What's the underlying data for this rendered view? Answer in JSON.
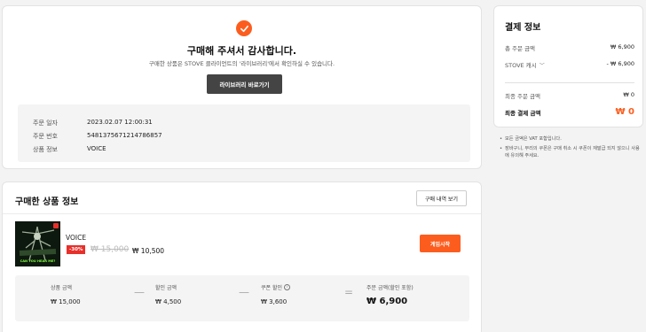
{
  "confirm": {
    "title": "구매해 주셔서 감사합니다.",
    "subtitle": "구매한 상품은 STOVE 클라이언트의 '라이브러리'에서 확인하실 수 있습니다.",
    "library_button": "라이브러리 바로가기",
    "order": [
      {
        "label": "주문 일자",
        "value": "2023.02.07 12:00:31"
      },
      {
        "label": "주문 번호",
        "value": "5481375671214786857"
      },
      {
        "label": "상품 정보",
        "value": "VOICE"
      }
    ]
  },
  "products": {
    "header": "구매한 상품 정보",
    "history_button": "구매 내역 보기",
    "item": {
      "thumb_text": "CAN YOU HEAR ME?",
      "name": "VOICE",
      "discount": "-30%",
      "original_price": "₩ 15,000",
      "sale_price": "₩ 10,500",
      "play_button": "게임시작"
    },
    "summary": {
      "product_amount_label": "상품 금액",
      "product_amount": "₩ 15,000",
      "discount_amount_label": "할인 금액",
      "discount_amount": "₩ 4,500",
      "coupon_label": "쿠폰 할인",
      "coupon_amount": "₩ 3,600",
      "order_amount_label": "주문 금액(할인 포함)",
      "order_amount": "₩ 6,900",
      "minus_1": "—",
      "minus_2": "—",
      "equals": "="
    }
  },
  "payment": {
    "title": "결제 정보",
    "total_order_label": "총 주문 금액",
    "total_order_value": "₩ 6,900",
    "stove_cash_label": "STOVE 캐시",
    "stove_cash_value": "- ₩ 6,900",
    "final_order_label": "최종 주문 금액",
    "final_order_value": "₩ 0",
    "final_pay_label": "최종 결제 금액",
    "final_pay_value": "₩ 0"
  },
  "notes": [
    "모든 금액은 VAT 포함입니다.",
    "장바구니, 무리의 쿠폰은 구매 취소 시 쿠폰이 재발급 되지 않으니 사용에 유의해 주세요."
  ],
  "colors": {
    "accent": "#fc5d1f",
    "discount_red": "#e8302b",
    "dark_button": "#444444"
  }
}
